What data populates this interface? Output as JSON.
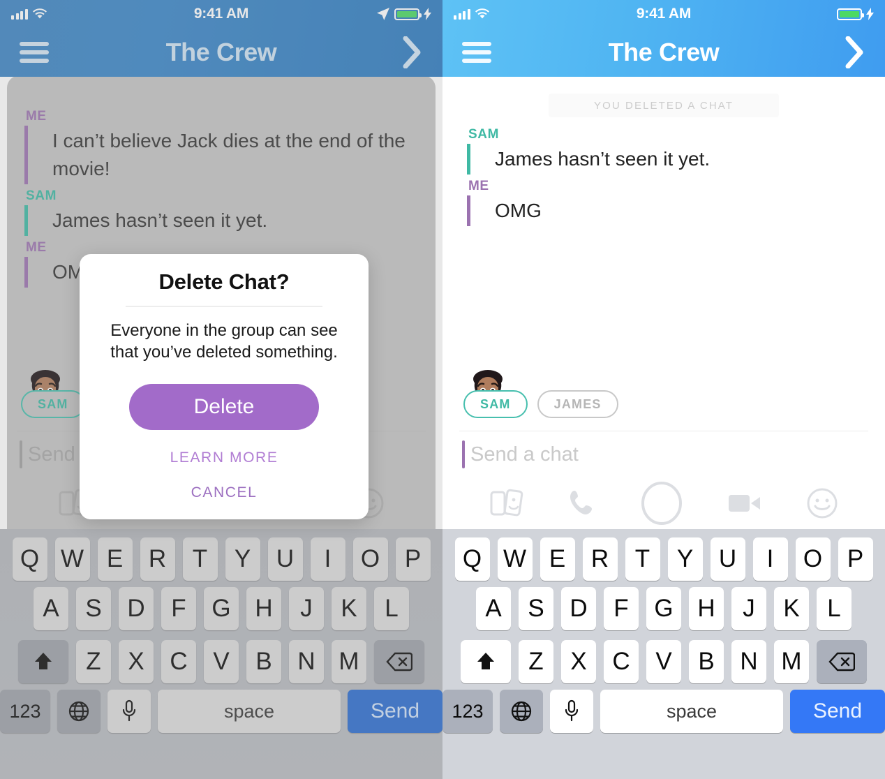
{
  "status_bar": {
    "time": "9:41 AM",
    "signal_icon": "cellular-bars-icon",
    "wifi_icon": "wifi-icon",
    "location_icon": "location-arrow-icon",
    "battery_icon": "battery-icon",
    "charging_icon": "lightning-bolt-icon"
  },
  "nav": {
    "menu_icon": "hamburger-menu-icon",
    "title": "The Crew",
    "forward_icon": "chevron-right-icon"
  },
  "colors": {
    "me_accent": "#9b72b0",
    "sam_accent": "#3fb9a4",
    "delete_button": "#a26bc9",
    "link_purple": "#b07cd3",
    "send_button": "#3478f6",
    "header_blue_left": "#3c87c8",
    "header_blue_right": "#4fb4f2"
  },
  "left_panel": {
    "messages": [
      {
        "sender": "ME",
        "text": "I can’t believe Jack dies at the end of the movie!",
        "accent": "me"
      },
      {
        "sender": "SAM",
        "text": "James hasn’t seen it yet.",
        "accent": "sam"
      },
      {
        "sender": "ME",
        "text": "OMG",
        "accent": "me"
      }
    ],
    "friends": [
      {
        "label": "SAM",
        "has_bitmoji": true
      }
    ],
    "composer": {
      "placeholder": "Send a chat"
    },
    "action_icons": [
      "snap-card-icon",
      "smiley-sticker-icon"
    ]
  },
  "right_panel": {
    "deleted_banner": "YOU DELETED A CHAT",
    "messages": [
      {
        "sender": "SAM",
        "text": "James hasn’t seen it yet.",
        "accent": "sam"
      },
      {
        "sender": "ME",
        "text": "OMG",
        "accent": "me"
      }
    ],
    "friends": [
      {
        "label": "SAM",
        "has_bitmoji": true
      },
      {
        "label": "JAMES",
        "has_bitmoji": false
      }
    ],
    "composer": {
      "placeholder": "Send a chat"
    },
    "action_icons": [
      "snap-card-icon",
      "phone-call-icon",
      "capture-circle-icon",
      "video-camera-icon",
      "smiley-sticker-icon"
    ]
  },
  "modal": {
    "title": "Delete Chat?",
    "body": "Everyone in the group can see that you’ve deleted something.",
    "primary_button": "Delete",
    "learn_more": "LEARN MORE",
    "cancel": "CANCEL"
  },
  "keyboard": {
    "row1": [
      "Q",
      "W",
      "E",
      "R",
      "T",
      "Y",
      "U",
      "I",
      "O",
      "P"
    ],
    "row2": [
      "A",
      "S",
      "D",
      "F",
      "G",
      "H",
      "J",
      "K",
      "L"
    ],
    "row3": [
      "Z",
      "X",
      "C",
      "V",
      "B",
      "N",
      "M"
    ],
    "shift_icon": "shift-arrow-icon",
    "backspace_icon": "backspace-icon",
    "numeric_key": "123",
    "globe_icon": "globe-icon",
    "mic_icon": "microphone-icon",
    "space_key": "space",
    "send_key": "Send"
  }
}
